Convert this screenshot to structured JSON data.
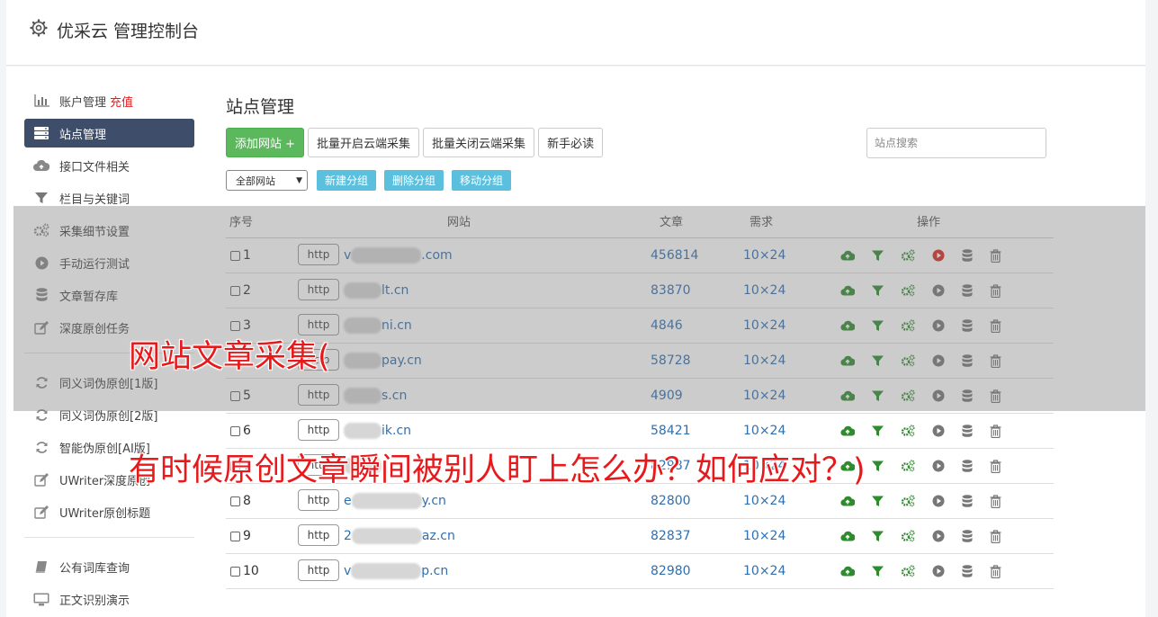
{
  "header": {
    "title": "优采云 管理控制台"
  },
  "sidebar": {
    "items": [
      {
        "label": "账户管理",
        "badge": "充值",
        "icon": "bar-chart-icon"
      },
      {
        "label": "站点管理",
        "icon": "server-icon",
        "active": true
      },
      {
        "label": "接口文件相关",
        "icon": "cloud-upload-icon"
      },
      {
        "label": "栏目与关键词",
        "icon": "filter-icon"
      },
      {
        "label": "采集细节设置",
        "icon": "cogs-icon"
      },
      {
        "label": "手动运行测试",
        "icon": "play-circle-icon"
      },
      {
        "label": "文章暂存库",
        "icon": "database-icon"
      },
      {
        "label": "深度原创任务",
        "icon": "edit-icon"
      }
    ],
    "items2": [
      {
        "label": "同义词伪原创[1版]",
        "icon": "refresh-icon"
      },
      {
        "label": "同义词伪原创[2版]",
        "icon": "refresh-icon"
      },
      {
        "label": "智能伪原创[AI版]",
        "icon": "refresh-icon"
      },
      {
        "label": "UWriter深度原创",
        "icon": "edit-icon"
      },
      {
        "label": "UWriter原创标题",
        "icon": "edit-icon"
      }
    ],
    "items3": [
      {
        "label": "公有词库查询",
        "icon": "book-icon"
      },
      {
        "label": "正文识别演示",
        "icon": "monitor-icon"
      }
    ]
  },
  "main": {
    "title": "站点管理",
    "toolbar": {
      "add": "添加网站 +",
      "batch_open": "批量开启云端采集",
      "batch_close": "批量关闭云端采集",
      "guide": "新手必读"
    },
    "search_placeholder": "站点搜索",
    "group_select": "全部网站",
    "group_buttons": [
      "新建分组",
      "删除分组",
      "移动分组"
    ],
    "table": {
      "headers": {
        "no": "序号",
        "site": "网站",
        "articles": "文章",
        "demand": "需求",
        "ops": "操作"
      },
      "rows": [
        {
          "no": "1",
          "proto": "http",
          "pre": "v",
          "suf": ".com",
          "articles": "456814",
          "demand": "10×24",
          "running": true
        },
        {
          "no": "2",
          "proto": "http",
          "pre": "",
          "suf": "lt.cn",
          "articles": "83870",
          "demand": "10×24",
          "running": false
        },
        {
          "no": "3",
          "proto": "http",
          "pre": "",
          "suf": "ni.cn",
          "articles": "4846",
          "demand": "10×24",
          "running": false
        },
        {
          "no": "4",
          "proto": "http",
          "pre": "",
          "suf": "pay.cn",
          "articles": "58728",
          "demand": "10×24",
          "running": false
        },
        {
          "no": "5",
          "proto": "http",
          "pre": "",
          "suf": "s.cn",
          "articles": "4909",
          "demand": "10×24",
          "running": false
        },
        {
          "no": "6",
          "proto": "http",
          "pre": "",
          "suf": "ik.cn",
          "articles": "58421",
          "demand": "10×24",
          "running": false
        },
        {
          "no": "7",
          "proto": "http",
          "pre": "",
          "suf": "",
          "articles": "82987",
          "demand": "10×24",
          "running": false
        },
        {
          "no": "8",
          "proto": "http",
          "pre": "e",
          "suf": "y.cn",
          "articles": "82800",
          "demand": "10×24",
          "running": false
        },
        {
          "no": "9",
          "proto": "http",
          "pre": "2",
          "suf": "az.cn",
          "articles": "82837",
          "demand": "10×24",
          "running": false
        },
        {
          "no": "10",
          "proto": "http",
          "pre": "v",
          "suf": "p.cn",
          "articles": "82980",
          "demand": "10×24",
          "running": false
        }
      ]
    }
  },
  "caption": {
    "line1": "网站文章采集(",
    "line2": "有时候原创文章瞬间被别人盯上怎么办？如何应对？)"
  },
  "colors": {
    "active_nav": "#3e4e6a",
    "primary": "#5cb85c",
    "info": "#5bc0de",
    "link": "#2f6fb0",
    "caption": "#e8191b"
  }
}
